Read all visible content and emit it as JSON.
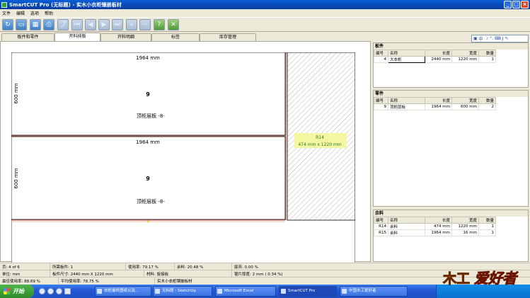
{
  "window": {
    "title": "SmartCUT Pro (无标题) - 实木小衣柜镶嵌板材"
  },
  "menu": [
    "文件",
    "编辑",
    "选项",
    "帮助"
  ],
  "tabs": [
    "板件和零件",
    "开料排版",
    "开料明细",
    "标签",
    "库存管理"
  ],
  "active_tab": 1,
  "mini_toolbar": [
    "中",
    "J"
  ],
  "layout": {
    "parts": [
      {
        "dim_top": "1964 mm",
        "dim_side": "600 mm",
        "number": "9",
        "name": "顶柜层板  -8-"
      },
      {
        "dim_top": "1964 mm",
        "dim_side": "600 mm",
        "number": "9",
        "name": "顶柜层板  -8-"
      }
    ],
    "remnant": {
      "id": "R14",
      "size": "474 mm x 1220 mm"
    }
  },
  "sheets_panel": {
    "title": "板件",
    "headers": [
      "编号",
      "名称",
      "长度",
      "宽度",
      "数量"
    ],
    "rows": [
      [
        "4",
        "大衣柜",
        "2440 mm",
        "1220 mm",
        "1"
      ]
    ]
  },
  "parts_panel": {
    "title": "零件",
    "headers": [
      "编号",
      "名称",
      "长度",
      "宽度",
      "数量"
    ],
    "rows": [
      [
        "9",
        "顶柜层板",
        "1964 mm",
        "600 mm",
        "2"
      ]
    ]
  },
  "offcuts_panel": {
    "title": "余料",
    "headers": [
      "编号",
      "名称",
      "长度",
      "宽度",
      "数量"
    ],
    "rows": [
      [
        "R14",
        "余料",
        "474 mm",
        "1220 mm",
        "1"
      ],
      [
        "R15",
        "余料",
        "1964 mm",
        "16 mm",
        "1"
      ]
    ]
  },
  "status": {
    "row1": [
      "页: 4 of 6",
      "所需板件: 1",
      "使用率: 79.17 %",
      "余料: 20.48 %",
      "废弃: 0.00 %"
    ],
    "row2": [
      "单位: mm",
      "板件尺寸: 2440 mm X 1220 mm",
      "材料: 旋接板",
      "锯片厚度: 2 mm  ( 0.34 %)"
    ],
    "row3": [
      "最佳使用率: 88.69 %",
      "平均使用率: 78.75 %",
      "实木小衣柜镶嵌板材"
    ]
  },
  "taskbar": {
    "start": "开始",
    "tasks": [
      "衣柜最终图纸以及...",
      "无标题 - SketchUp",
      "Microsoft Excel",
      "SmartCUT Pro",
      "中国木工爱好者"
    ],
    "logo_text": "爱好者",
    "logo_mark": "木工"
  },
  "colors": {
    "accent": "#0a5fd8",
    "remnant_label_bg": "#f4f7a0",
    "sheet_border": "#c23b2b"
  }
}
